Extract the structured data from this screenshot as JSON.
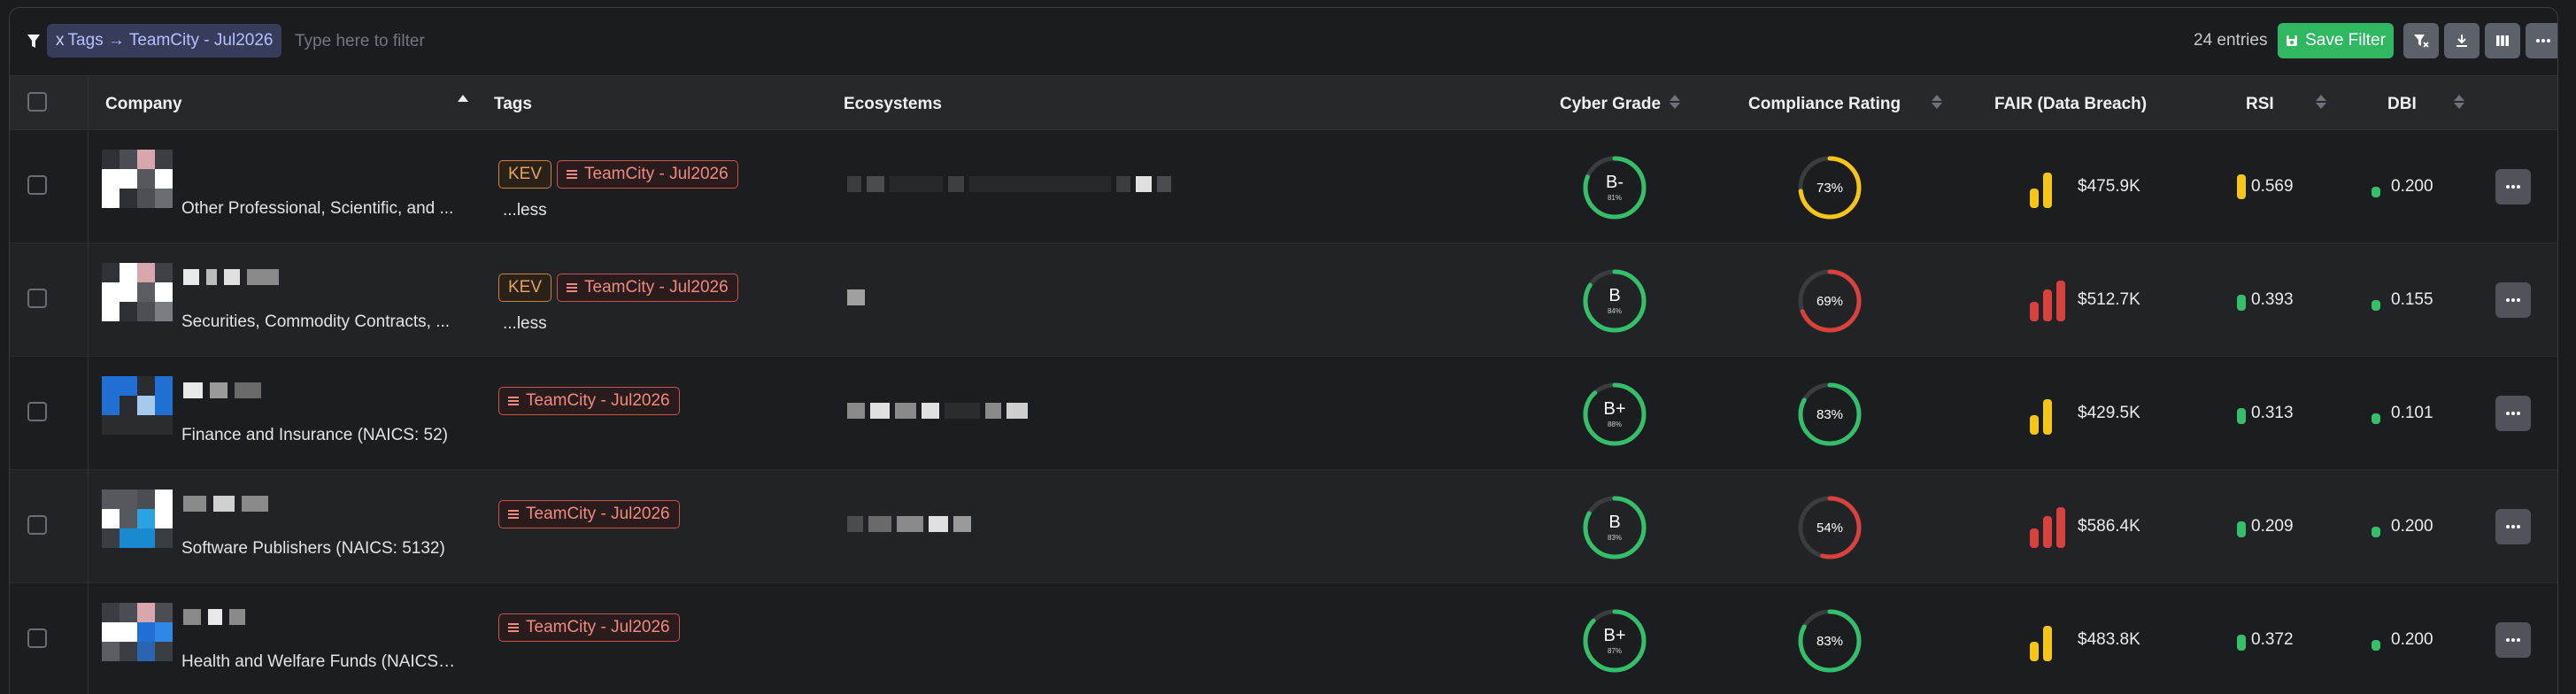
{
  "toolbar": {
    "chip_label": "Tags → TeamCity - Jul2026",
    "chip_remove": "x",
    "filter_placeholder": "Type here to filter",
    "entries": "24 entries",
    "save_label": "Save Filter"
  },
  "columns": {
    "company": "Company",
    "tags": "Tags",
    "ecosystems": "Ecosystems",
    "cyber_grade": "Cyber Grade",
    "compliance": "Compliance Rating",
    "fair": "FAIR (Data Breach)",
    "rsi": "RSI",
    "dbi": "DBI"
  },
  "colors": {
    "green": "#34c06a",
    "red": "#d9423c",
    "yellow": "#f5c518",
    "accent_chip": "#363c5a",
    "save": "#2fb761"
  },
  "rows": [
    {
      "industry": "Other Professional, Scientific, and ...",
      "tags": [
        "KEV",
        "TeamCity - Jul2026"
      ],
      "less": "...less",
      "grade": "B-",
      "grade_pct": "81%",
      "grade_fill": 0.81,
      "compliance": "73%",
      "compliance_fill": 0.73,
      "compliance_color": "yellow",
      "fair": "$475.9K",
      "fair_bars": "yellow-2",
      "rsi": "0.569",
      "rsi_color": "yellow",
      "dbi": "0.200"
    },
    {
      "industry": "Securities, Commodity Contracts, ...",
      "tags": [
        "KEV",
        "TeamCity - Jul2026"
      ],
      "less": "...less",
      "grade": "B",
      "grade_pct": "84%",
      "grade_fill": 0.84,
      "compliance": "69%",
      "compliance_fill": 0.69,
      "compliance_color": "red",
      "fair": "$512.7K",
      "fair_bars": "red-3",
      "rsi": "0.393",
      "rsi_color": "green",
      "dbi": "0.155"
    },
    {
      "industry": "Finance and Insurance (NAICS: 52)",
      "tags": [
        "TeamCity - Jul2026"
      ],
      "less": "",
      "grade": "B+",
      "grade_pct": "88%",
      "grade_fill": 0.88,
      "compliance": "83%",
      "compliance_fill": 0.83,
      "compliance_color": "green",
      "fair": "$429.5K",
      "fair_bars": "yellow-2",
      "rsi": "0.313",
      "rsi_color": "green",
      "dbi": "0.101"
    },
    {
      "industry": "Software Publishers (NAICS: 5132)",
      "tags": [
        "TeamCity - Jul2026"
      ],
      "less": "",
      "grade": "B",
      "grade_pct": "83%",
      "grade_fill": 0.83,
      "compliance": "54%",
      "compliance_fill": 0.54,
      "compliance_color": "red",
      "fair": "$586.4K",
      "fair_bars": "red-3",
      "rsi": "0.209",
      "rsi_color": "green",
      "dbi": "0.200"
    },
    {
      "industry": "Health and Welfare Funds (NAICS: ...",
      "tags": [
        "TeamCity - Jul2026"
      ],
      "less": "",
      "grade": "B+",
      "grade_pct": "87%",
      "grade_fill": 0.87,
      "compliance": "83%",
      "compliance_fill": 0.83,
      "compliance_color": "green",
      "fair": "$483.8K",
      "fair_bars": "yellow-2",
      "rsi": "0.372",
      "rsi_color": "green",
      "dbi": "0.200"
    }
  ]
}
